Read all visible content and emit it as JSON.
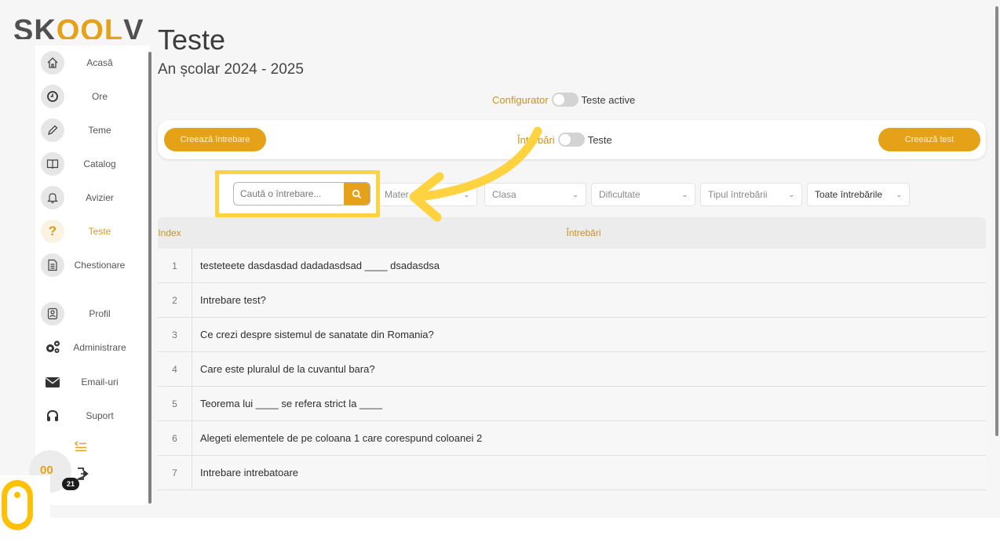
{
  "brand": {
    "text_a": "SK",
    "text_b": "OOL",
    "text_c": "VERS"
  },
  "sidebar": {
    "items": [
      {
        "label": "Acasă",
        "icon": "home-icon"
      },
      {
        "label": "Ore",
        "icon": "clock-icon"
      },
      {
        "label": "Teme",
        "icon": "pencil-icon"
      },
      {
        "label": "Catalog",
        "icon": "book-icon"
      },
      {
        "label": "Avizier",
        "icon": "bell-icon"
      },
      {
        "label": "Teste",
        "icon": "question-icon"
      },
      {
        "label": "Chestionare",
        "icon": "document-icon"
      },
      {
        "label": "Profil",
        "icon": "profile-icon"
      },
      {
        "label": "Administrare",
        "icon": "gears-icon"
      },
      {
        "label": "Email-uri",
        "icon": "mail-icon"
      },
      {
        "label": "Suport",
        "icon": "headset-icon"
      }
    ],
    "avatar_text": "00",
    "badge_count": "21"
  },
  "header": {
    "title": "Teste",
    "subtitle": "An școlar 2024 - 2025",
    "toggle_left": "Configurator",
    "toggle_right": "Teste active"
  },
  "action_bar": {
    "create_question": "Creează întrebare",
    "toggle_left": "Întrebări",
    "toggle_right": "Teste",
    "create_test": "Creează test"
  },
  "filters": {
    "search_placeholder": "Caută o întrebare...",
    "subject": "Mater",
    "class": "Clasa",
    "difficulty": "Dificultate",
    "question_type": "Tipul întrebării",
    "all_questions": "Toate întrebările"
  },
  "table": {
    "col_index": "Index",
    "col_question": "Întrebări",
    "rows": [
      {
        "index": "1",
        "question": "testeteete dasdasdad dadadasdsad ____ dsadasdsa"
      },
      {
        "index": "2",
        "question": "Intrebare test?"
      },
      {
        "index": "3",
        "question": "Ce crezi despre sistemul de sanatate din Romania?"
      },
      {
        "index": "4",
        "question": "Care este pluralul de la cuvantul bara?"
      },
      {
        "index": "5",
        "question": "Teorema lui ____ se refera strict la ____"
      },
      {
        "index": "6",
        "question": "Alegeti elementele de pe coloana 1 care corespund coloanei 2"
      },
      {
        "index": "7",
        "question": "Intrebare intrebatoare"
      }
    ]
  },
  "colors": {
    "accent": "#e5a117",
    "highlight": "#ffd23f"
  }
}
